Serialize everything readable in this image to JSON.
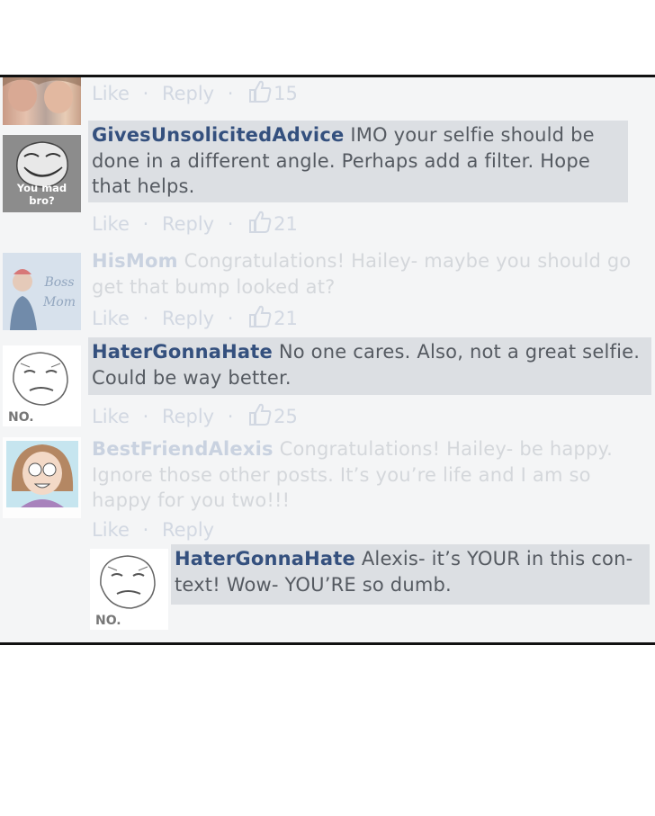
{
  "actions": {
    "like": "Like",
    "reply": "Reply",
    "dot": "·"
  },
  "comments": [
    {
      "likes": "15"
    },
    {
      "author": "GivesUnsolicitedAdvice",
      "text": "IMO your selfie should be done in a different angle. Perhaps add a filter. Hope that helps.",
      "likes": "21",
      "avatar_caption": "You mad bro?"
    },
    {
      "author": "HisMom",
      "text": "Congratulations! Hailey- maybe you should go get that bump looked at?",
      "likes": "21",
      "avatar_caption": "Boss Mom"
    },
    {
      "author": "HaterGonnaHate",
      "text": "No one cares. Also, not a great selfie. Could be way better.",
      "likes": "25",
      "avatar_caption": "NO."
    },
    {
      "author": "BestFriendAlexis",
      "text": "Congratulations! Hailey- be happy. Ignore those other posts. It’s you’re life and I am so happy for you two!!!"
    },
    {
      "author": "HaterGonnaHate",
      "text": "Alexis- it’s YOUR in this con-text! Wow- YOU’RE so dumb.",
      "avatar_caption": "NO."
    }
  ],
  "colors": {
    "name": "#34507e",
    "highlight": "#dcdfe3",
    "faded_text": "#d4d7db",
    "border": "#111111"
  }
}
